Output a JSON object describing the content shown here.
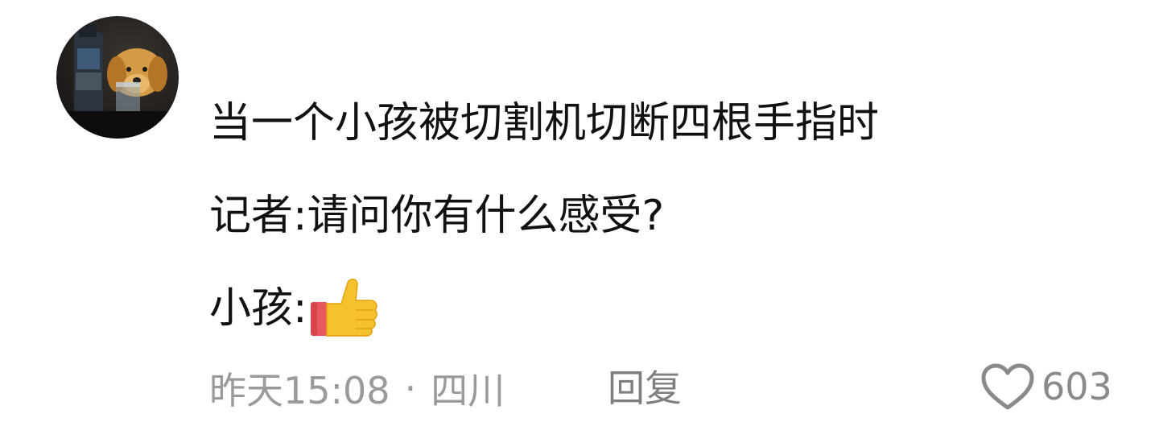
{
  "comment": {
    "avatar_icon": "dog-with-bottle-avatar",
    "lines": [
      "当一个小孩被切割机切断四根手指时",
      "记者:请问你有什么感受?",
      "小孩:"
    ],
    "reaction_icon": "thumbs-up-icon",
    "timestamp": "昨天15:08",
    "separator": "·",
    "location": "四川",
    "reply_label": "回复",
    "like_count": "603"
  },
  "colors": {
    "text": "#111111",
    "meta": "#9a9a9a",
    "thumb_yellow": "#f7c12b",
    "cuff_red": "#e8595f"
  }
}
